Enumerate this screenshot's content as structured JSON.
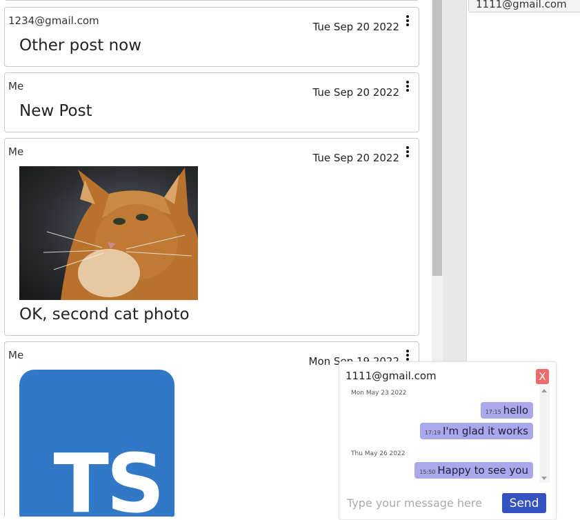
{
  "posts": [
    {
      "author": "",
      "date": ""
    },
    {
      "author": "1234@gmail.com",
      "date": "Tue Sep 20 2022",
      "text": "Other post now"
    },
    {
      "author": "Me",
      "date": "Tue Sep 20 2022",
      "text": "New Post"
    },
    {
      "author": "Me",
      "date": "Tue Sep 20 2022",
      "text": "OK, second cat photo",
      "image": "cat-photo"
    },
    {
      "author": "Me",
      "date": "Mon Sep 19 2022",
      "image": "typescript-logo",
      "image_text": "TS"
    }
  ],
  "contacts": [
    {
      "email": "1111@gmail.com"
    }
  ],
  "chat": {
    "title": "1111@gmail.com",
    "close_label": "X",
    "days": [
      {
        "label": "Mon May 23 2022"
      },
      {
        "label": "Thu May 26 2022"
      }
    ],
    "messages": [
      {
        "time": "17:15",
        "text": "hello"
      },
      {
        "time": "17:19",
        "text": "I'm glad it works"
      },
      {
        "time": "15:50",
        "text": "Happy to see you"
      }
    ],
    "input_placeholder": "Type your message here",
    "send_label": "Send"
  },
  "colors": {
    "bubble": "#aaa7ea",
    "send_button": "#3552c0",
    "close_button": "#ec6b6b",
    "ts_logo": "#3178c6"
  },
  "icons": [
    "more-vertical-icon",
    "scroll-up-icon",
    "scroll-down-icon"
  ]
}
